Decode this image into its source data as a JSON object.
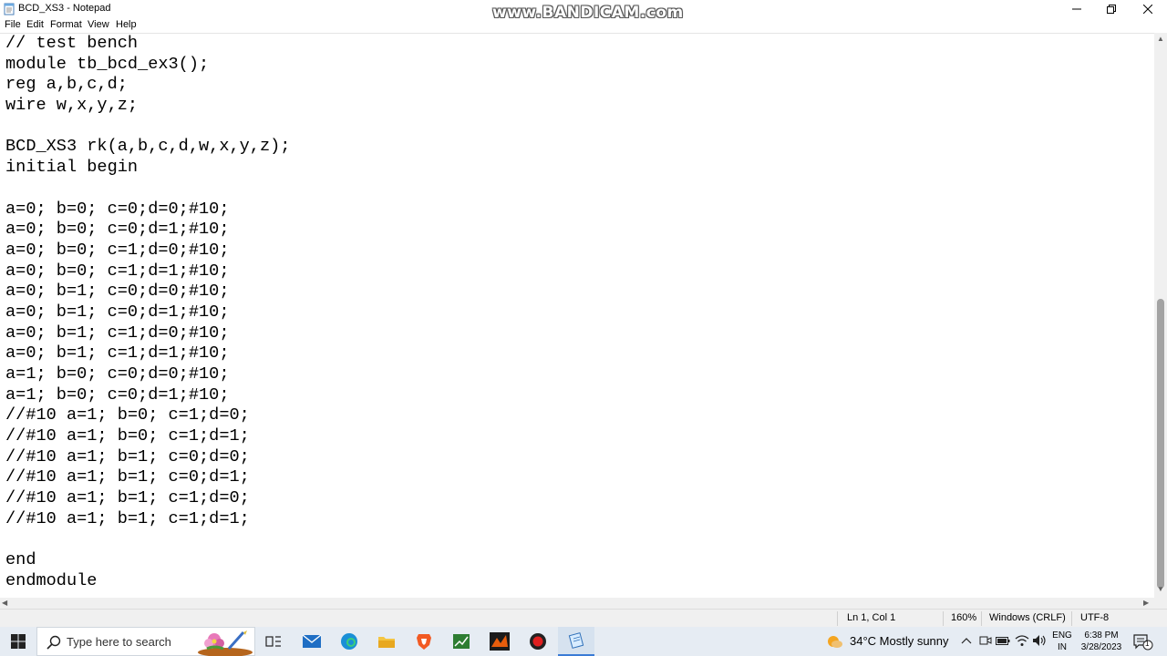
{
  "window": {
    "title": "BCD_XS3 - Notepad",
    "watermark": "www.BANDICAM.com"
  },
  "menu": [
    "File",
    "Edit",
    "Format",
    "View",
    "Help"
  ],
  "editor": {
    "lines": [
      "// test bench",
      "module tb_bcd_ex3();",
      "reg a,b,c,d;",
      "wire w,x,y,z;",
      "",
      "BCD_XS3 rk(a,b,c,d,w,x,y,z);",
      "initial begin",
      "",
      "a=0; b=0; c=0;d=0;#10;",
      "a=0; b=0; c=0;d=1;#10;",
      "a=0; b=0; c=1;d=0;#10;",
      "a=0; b=0; c=1;d=1;#10;",
      "a=0; b=1; c=0;d=0;#10;",
      "a=0; b=1; c=0;d=1;#10;",
      "a=0; b=1; c=1;d=0;#10;",
      "a=0; b=1; c=1;d=1;#10;",
      "a=1; b=0; c=0;d=0;#10;",
      "a=1; b=0; c=0;d=1;#10;",
      "//#10 a=1; b=0; c=1;d=0;",
      "//#10 a=1; b=0; c=1;d=1;",
      "//#10 a=1; b=1; c=0;d=0;",
      "//#10 a=1; b=1; c=0;d=1;",
      "//#10 a=1; b=1; c=1;d=0;",
      "//#10 a=1; b=1; c=1;d=1;",
      "",
      "end",
      "endmodule"
    ]
  },
  "status": {
    "position": "Ln 1, Col 1",
    "zoom": "160%",
    "line_ending": "Windows (CRLF)",
    "encoding": "UTF-8"
  },
  "taskbar": {
    "search_placeholder": "Type here to search",
    "weather": "34°C  Mostly sunny",
    "lang_top": "ENG",
    "lang_bottom": "IN",
    "time": "6:38 PM",
    "date": "3/28/2023",
    "notification_count": "1"
  },
  "colors": {
    "taskbar_bg": "#e6ecf3",
    "status_bg": "#f0f0f0",
    "scroll_thumb": "#a3a3a3"
  }
}
